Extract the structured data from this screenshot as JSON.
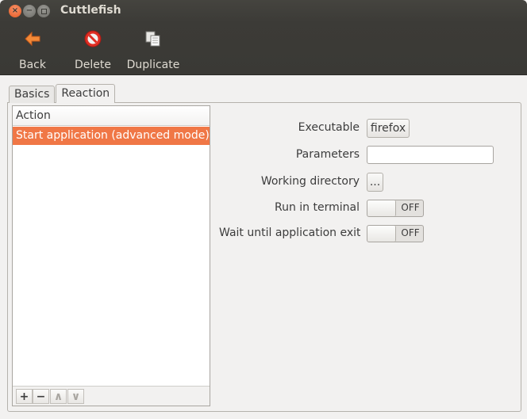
{
  "window": {
    "title": "Cuttlefish"
  },
  "toolbar": {
    "back_label": "Back",
    "delete_label": "Delete",
    "duplicate_label": "Duplicate"
  },
  "tabs": [
    {
      "label": "Basics",
      "active": false
    },
    {
      "label": "Reaction",
      "active": true
    }
  ],
  "action_list": {
    "header": "Action",
    "items": [
      {
        "label": "Start application (advanced mode)",
        "selected": true
      }
    ],
    "footer_buttons": [
      "+",
      "−",
      "∧",
      "∨"
    ]
  },
  "form": {
    "executable_label": "Executable",
    "executable_value": "firefox",
    "parameters_label": "Parameters",
    "parameters_value": "",
    "working_directory_label": "Working directory",
    "working_directory_button": "...",
    "run_in_terminal_label": "Run in terminal",
    "run_in_terminal_state": "OFF",
    "wait_until_exits_label": "Wait until application exits",
    "wait_until_exits_state": "OFF"
  },
  "colors": {
    "selection": "#f07746",
    "toolbar_bg": "#3c3b37",
    "close_button": "#e45a22"
  }
}
